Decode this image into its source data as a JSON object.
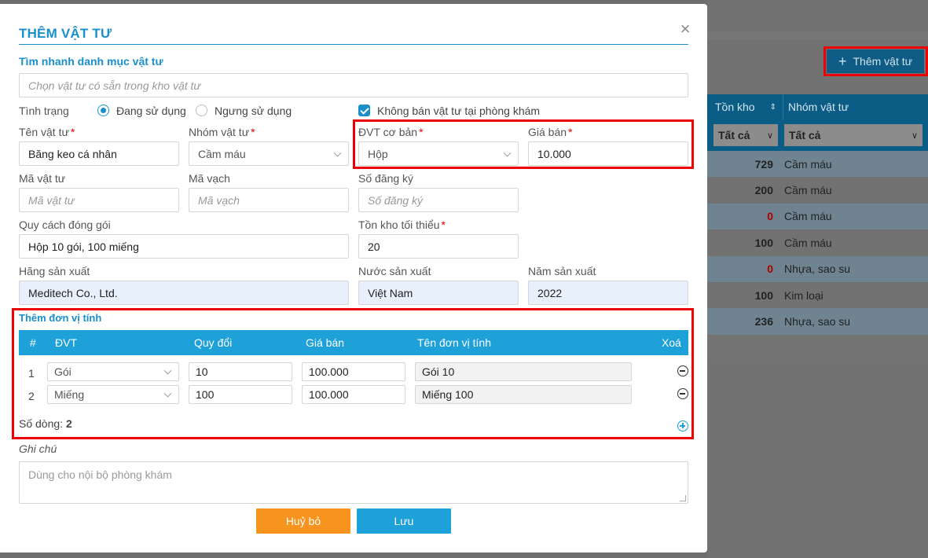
{
  "background": {
    "add_button_label": "Thêm vật tư",
    "table": {
      "columns": [
        "Tồn kho",
        "Nhóm vật tư"
      ],
      "filters": [
        "Tất cả",
        "Tất cả"
      ],
      "rows": [
        {
          "stock": "729",
          "group": "Cầm máu"
        },
        {
          "stock": "200",
          "group": "Cầm máu"
        },
        {
          "stock": "0",
          "group": "Cầm máu"
        },
        {
          "stock": "100",
          "group": "Cầm máu"
        },
        {
          "stock": "0",
          "group": "Nhựa, sao su"
        },
        {
          "stock": "100",
          "group": "Kim loại"
        },
        {
          "stock": "236",
          "group": "Nhựa, sao su"
        }
      ]
    }
  },
  "modal": {
    "title": "THÊM VẬT TƯ",
    "quick_search": {
      "label": "Tìm nhanh danh mục vật tư",
      "placeholder": "Chọn vật tư có sẵn trong kho vật tư"
    },
    "status": {
      "label": "Tình trạng",
      "options": [
        "Đang sử dụng",
        "Ngưng sử dụng"
      ],
      "selected": "Đang sử dụng"
    },
    "no_sale_checkbox": {
      "label": "Không bán vật tư tại phòng khám",
      "checked": true
    },
    "fields": {
      "name": {
        "label": "Tên vật tư",
        "value": "Băng keo cá nhân"
      },
      "group": {
        "label": "Nhóm vật tư",
        "value": "Cầm máu"
      },
      "base_unit": {
        "label": "ĐVT cơ bản",
        "value": "Hộp"
      },
      "price": {
        "label": "Giá bán",
        "value": "10.000"
      },
      "code": {
        "label": "Mã vật tư",
        "placeholder": "Mã vật tư"
      },
      "barcode": {
        "label": "Mã vạch",
        "placeholder": "Mã vạch"
      },
      "reg_no": {
        "label": "Số đăng ký",
        "placeholder": "Số đăng ký"
      },
      "packing": {
        "label": "Quy cách đóng gói",
        "value": "Hộp 10 gói,  100 miếng"
      },
      "min_stock": {
        "label": "Tồn kho tối thiểu",
        "value": "20"
      },
      "manufacturer": {
        "label": "Hãng sản xuất",
        "value": "Meditech Co., Ltd."
      },
      "country": {
        "label": "Nước sản xuất",
        "value": "Việt Nam"
      },
      "year": {
        "label": "Năm sản xuất",
        "value": "2022"
      }
    },
    "units": {
      "label": "Thêm đơn vị tính",
      "columns": {
        "num": "#",
        "unit": "ĐVT",
        "conversion": "Quy đổi",
        "price": "Giá bán",
        "unit_name": "Tên đơn vị tính",
        "delete": "Xoá"
      },
      "rows": [
        {
          "num": "1",
          "unit": "Gói",
          "conversion": "10",
          "price": "100.000",
          "unit_name": "Gói 10"
        },
        {
          "num": "2",
          "unit": "Miếng",
          "conversion": "100",
          "price": "100.000",
          "unit_name": "Miếng 100"
        }
      ],
      "row_count_label": "Số dòng:",
      "row_count": "2"
    },
    "note": {
      "label": "Ghi chú",
      "placeholder": "Dùng cho nội bộ phòng khám"
    },
    "buttons": {
      "cancel": "Huỷ bỏ",
      "save": "Lưu"
    }
  }
}
